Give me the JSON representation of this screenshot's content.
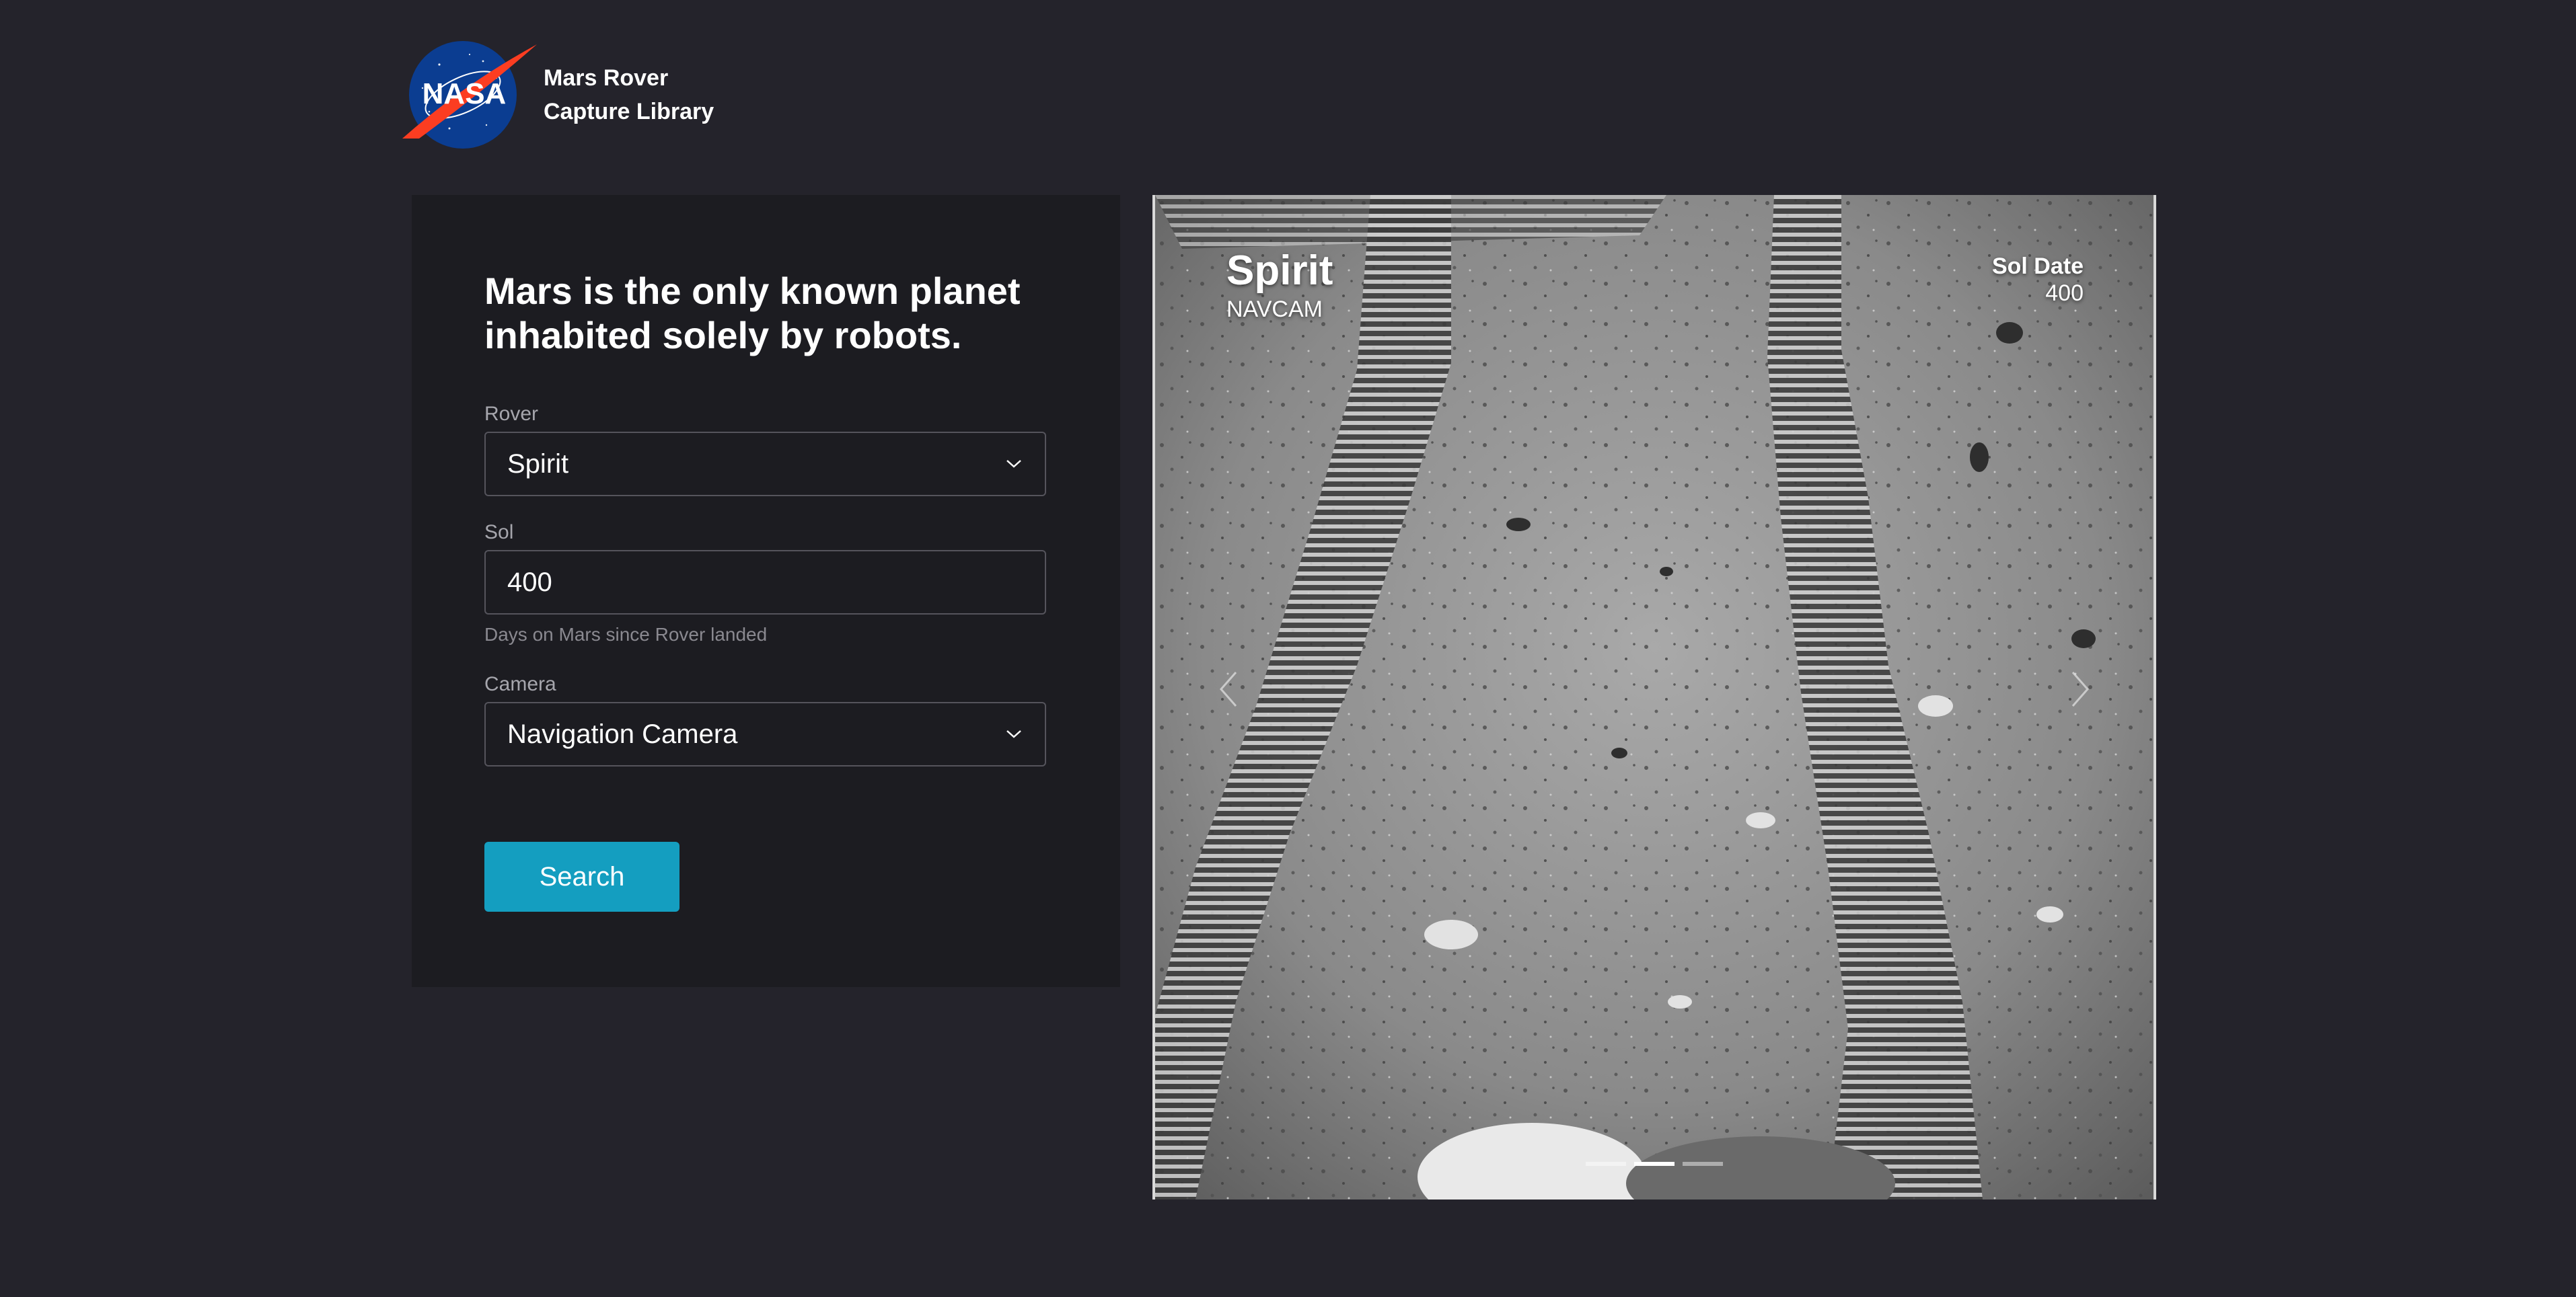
{
  "header": {
    "logo_icon": "nasa-meatball-logo",
    "logo_text": "NASA",
    "title_line1": "Mars Rover",
    "title_line2": "Capture Library"
  },
  "search": {
    "headline": "Mars is the only known planet inhabited solely by robots.",
    "rover": {
      "label": "Rover",
      "value": "Spirit"
    },
    "sol": {
      "label": "Sol",
      "value": "400",
      "helper": "Days on Mars since Rover landed"
    },
    "camera": {
      "label": "Camera",
      "value": "Navigation Camera"
    },
    "button_label": "Search"
  },
  "photo": {
    "rover": "Spirit",
    "camera": "NAVCAM",
    "sol_label": "Sol Date",
    "sol_value": "400",
    "prev_icon": "chevron-left-icon",
    "next_icon": "chevron-right-icon",
    "indicator_count": 3,
    "active_indicator": 2
  },
  "colors": {
    "background": "#24232b",
    "panel": "#1c1c21",
    "accent": "#149ec0",
    "input_border": "#55545c"
  }
}
